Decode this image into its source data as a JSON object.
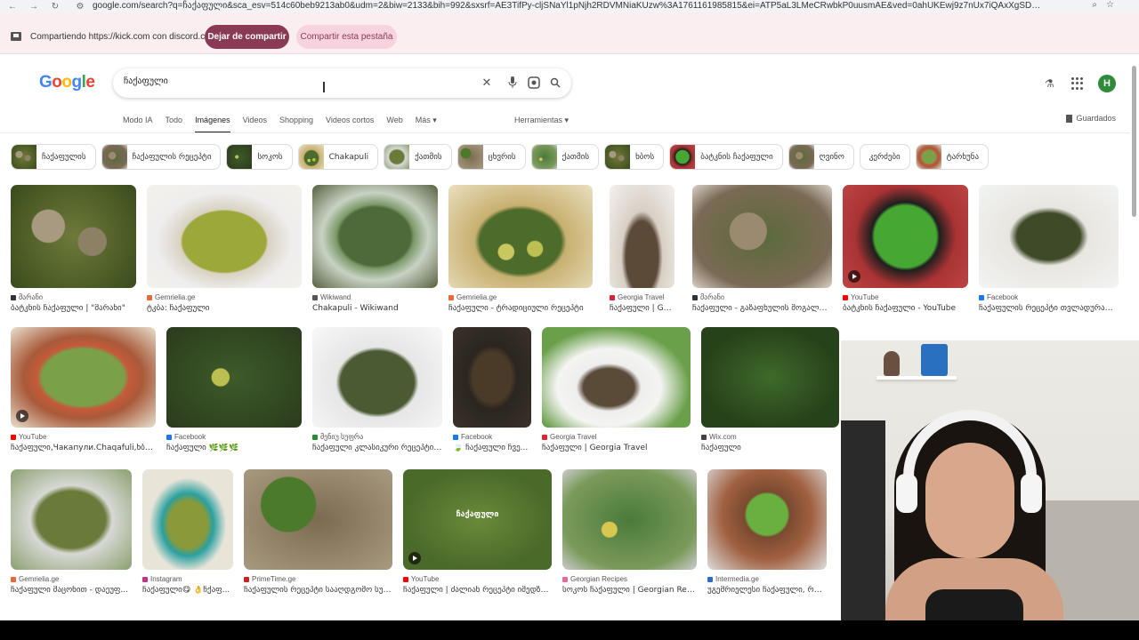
{
  "browser": {
    "url": "google.com/search?q=ჩაქაფული&sca_esv=514c60beb9213ab0&udm=2&biw=2133&bih=992&sxsrf=AE3TifPy-cljSNaYl1pNjh2RDVMNiaKUzw%3A1761161985815&ei=ATP5aL3LMeCRwbkP0uusmAE&ved=0ahUKEwj9z7nUx7iQAxXgSDABHdI1CxMQ4dUDC..."
  },
  "share": {
    "message": "Compartiendo https://kick.com con discord.com",
    "stop_label": "Dejar de compartir",
    "share_tab_label": "Compartir esta pestaña"
  },
  "search": {
    "query": "ჩაქაფული",
    "avatar_letter": "H"
  },
  "tabs": [
    "Modo IA",
    "Todo",
    "Imágenes",
    "Videos",
    "Shopping",
    "Videos cortos",
    "Web",
    "Más ▾"
  ],
  "active_tab": "Imágenes",
  "tools_label": "Herramientas ▾",
  "saved_label": "Guardados",
  "chips": [
    {
      "label": "ჩაქაფულის",
      "img": "food-a"
    },
    {
      "label": "ჩაქაფულის რეცეპტი",
      "img": "food-f"
    },
    {
      "label": "სოკოს",
      "img": "food-j"
    },
    {
      "label": "Chakapuli",
      "img": "food-d"
    },
    {
      "label": "ქათმის",
      "img": "food-o"
    },
    {
      "label": "ცხვრის",
      "img": "food-q"
    },
    {
      "label": "ქათმის",
      "img": "food-s"
    },
    {
      "label": "ხბოს",
      "img": "food-a"
    },
    {
      "label": "ბატკნის ჩაქაფული",
      "img": "food-g"
    },
    {
      "label": "ღვინო",
      "img": "food-f"
    },
    {
      "label": "კერძები",
      "img": ""
    },
    {
      "label": "ტარხუნა",
      "img": "food-i"
    }
  ],
  "results": [
    {
      "source": "მარანი",
      "title": "ბატკნის ჩაქაფული | \"მარანი\"",
      "img": "food-a",
      "fav": "#333",
      "video": false
    },
    {
      "source": "Gemrielia.ge",
      "title": "ტკბა: ჩაქაფული",
      "img": "food-b",
      "fav": "#e86a3a",
      "video": false
    },
    {
      "source": "Wikiwand",
      "title": "Chakapuli - Wikiwand",
      "img": "food-c",
      "fav": "#555",
      "video": false
    },
    {
      "source": "Gemrielia.ge",
      "title": "ჩაქაფული - ტრადიციული რეცეპტი",
      "img": "food-d",
      "fav": "#e86a3a",
      "video": false
    },
    {
      "source": "Georgia Travel",
      "title": "ჩაქაფული | Georg...",
      "img": "food-e",
      "fav": "#d23",
      "video": false
    },
    {
      "source": "მარანი",
      "title": "ჩაქაფული - გაზაფხულის მოგალობ...",
      "img": "food-f",
      "fav": "#333",
      "video": false
    },
    {
      "source": "YouTube",
      "title": "ბატკნის ჩაქაფული - YouTube",
      "img": "food-g",
      "fav": "#f00",
      "video": true
    },
    {
      "source": "Facebook",
      "title": "ჩაქაფულის რეცეპტი თვლადურად ...",
      "img": "food-h",
      "fav": "#1877f2",
      "video": false
    },
    {
      "source": "YouTube",
      "title": "ჩაქაფული,Чакапули.Chaqafuli,ხბოს ჩ...",
      "img": "food-i",
      "fav": "#f00",
      "video": true
    },
    {
      "source": "Facebook",
      "title": "ჩაქაფული 🌿🌿🌿",
      "img": "food-j",
      "fav": "#1877f2",
      "video": false
    },
    {
      "source": "მენიუ სუფრა",
      "title": "ჩაქაფული კლასიკური რეცეპტი ...",
      "img": "food-k",
      "fav": "#2a8a3a",
      "video": false
    },
    {
      "source": "Facebook",
      "title": "🍃 ჩაქაფული ჩვე...",
      "img": "food-l",
      "fav": "#1877f2",
      "video": false
    },
    {
      "source": "Georgia Travel",
      "title": "ჩაქაფული | Georgia Travel",
      "img": "food-m",
      "fav": "#d23",
      "video": false
    },
    {
      "source": "Wix.com",
      "title": "ჩაქაფული",
      "img": "food-n",
      "fav": "#444",
      "video": false
    },
    {
      "source": "Gemrielia.ge",
      "title": "ჩაქაფული მაცონით - დაეუფ...",
      "img": "food-o",
      "fav": "#e86a3a",
      "video": false
    },
    {
      "source": "Instagram",
      "title": "ჩაქაფული😋 👌ჩქაფ...",
      "img": "food-p",
      "fav": "#c13584",
      "video": false
    },
    {
      "source": "PrimeTime.ge",
      "title": "ჩაქაფულის რეცეპტი სააღდგომო სუფ...",
      "img": "food-q",
      "fav": "#c22",
      "video": false
    },
    {
      "source": "YouTube",
      "title": "ჩაქაფული | ძალიან რეცეპტი იმედზე - Y...",
      "img": "food-r",
      "fav": "#f00",
      "video": true,
      "watermark": "ჩაქაფული"
    },
    {
      "source": "Georgian Recipes",
      "title": "სოკოს ჩაქაფული | Georgian Recipes",
      "img": "food-s",
      "fav": "#e86a9a",
      "video": false
    },
    {
      "source": "Intermedia.ge",
      "title": "უგემრიელესი ჩაქაფული, რომ...",
      "img": "food-t",
      "fav": "#2a6ad2",
      "video": false
    }
  ]
}
